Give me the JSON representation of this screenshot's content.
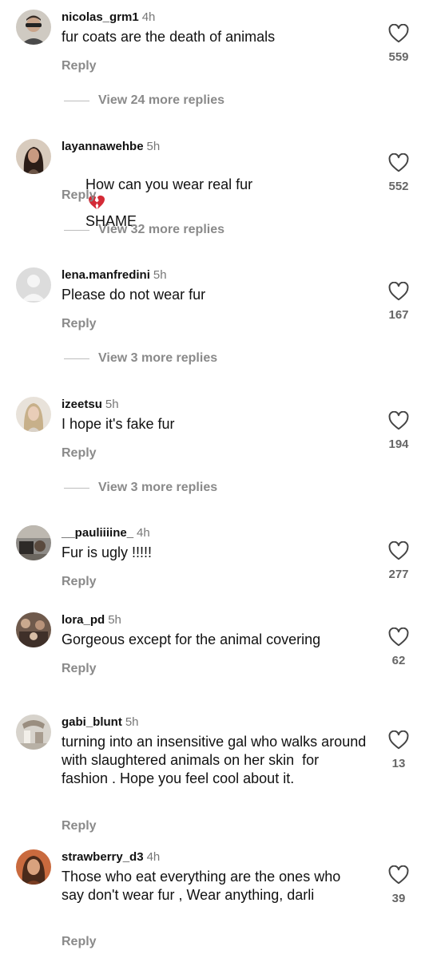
{
  "colors": {
    "text": "#111111",
    "muted": "#8a8a8a",
    "like_count": "#666666",
    "divider": "#bdbdbd"
  },
  "comments": [
    {
      "username": "nicolas_grm1",
      "time": "4h",
      "text": "fur coats are the death of animals",
      "reply_label": "Reply",
      "likes": "559",
      "view_replies": "View 24 more replies",
      "avatar_icon": "user-avatar-photo"
    },
    {
      "username": "layannawehbe",
      "time": "5h",
      "text_before": "How can you wear real fur",
      "emoji_icon": "broken-heart-emoji",
      "text_after": "SHAME",
      "reply_label": "Reply",
      "likes": "552",
      "view_replies": "View 32 more replies",
      "avatar_icon": "user-avatar-photo"
    },
    {
      "username": "lena.manfredini",
      "time": "5h",
      "text": "Please do not wear fur",
      "reply_label": "Reply",
      "likes": "167",
      "view_replies": "View 3 more replies",
      "avatar_icon": "default-avatar-icon"
    },
    {
      "username": "izeetsu",
      "time": "5h",
      "text": "I hope it's fake fur",
      "reply_label": "Reply",
      "likes": "194",
      "view_replies": "View 3 more replies",
      "avatar_icon": "user-avatar-photo"
    },
    {
      "username": "__pauliiiine_",
      "time": "4h",
      "text": "Fur is ugly !!!!!",
      "reply_label": "Reply",
      "likes": "277",
      "avatar_icon": "user-avatar-photo"
    },
    {
      "username": "lora_pd",
      "time": "5h",
      "text": "Gorgeous except for the animal covering",
      "reply_label": "Reply",
      "likes": "62",
      "avatar_icon": "user-avatar-photo"
    },
    {
      "username": "gabi_blunt",
      "time": "5h",
      "text": "turning into an insensitive gal who walks around with slaughtered animals on her skin  for fashion . Hope you feel cool about it.",
      "reply_label": "Reply",
      "likes": "13",
      "avatar_icon": "user-avatar-photo"
    },
    {
      "username": "strawberry_d3",
      "time": "4h",
      "text": "Those who eat everything are the ones who say don't wear fur , Wear anything, darli",
      "reply_label": "Reply",
      "likes": "39",
      "avatar_icon": "user-avatar-photo"
    }
  ]
}
